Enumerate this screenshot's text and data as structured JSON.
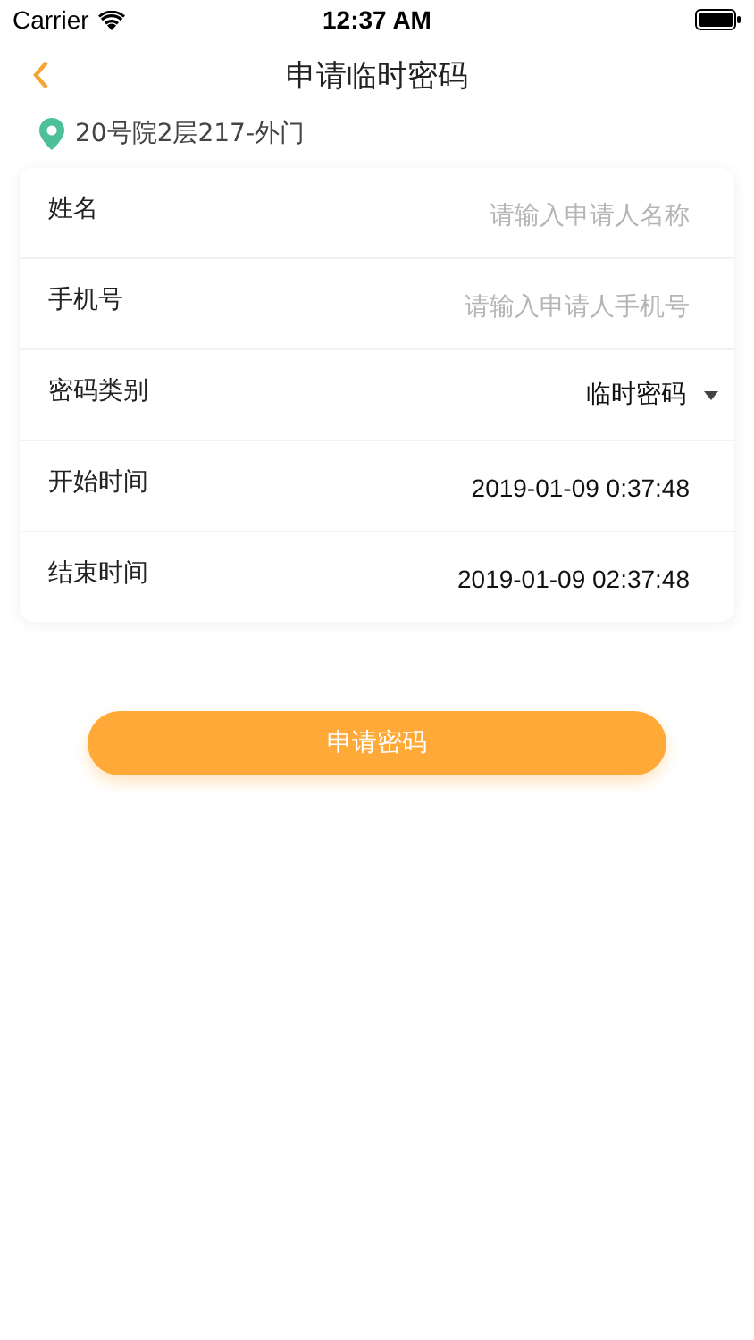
{
  "status_bar": {
    "carrier": "Carrier",
    "time": "12:37 AM"
  },
  "nav": {
    "title": "申请临时密码"
  },
  "location": "20号院2层217-外门",
  "form": [
    {
      "kind": "input",
      "label": "姓名",
      "placeholder": "请输入申请人名称"
    },
    {
      "kind": "input",
      "label": "手机号",
      "placeholder": "请输入申请人手机号"
    },
    {
      "kind": "select",
      "label": "密码类别",
      "value": "临时密码"
    },
    {
      "kind": "value",
      "label": "开始时间",
      "value": "2019-01-09 0:37:48"
    },
    {
      "kind": "value",
      "label": "结束时间",
      "value": "2019-01-09 02:37:48"
    }
  ],
  "submit": "申请密码"
}
